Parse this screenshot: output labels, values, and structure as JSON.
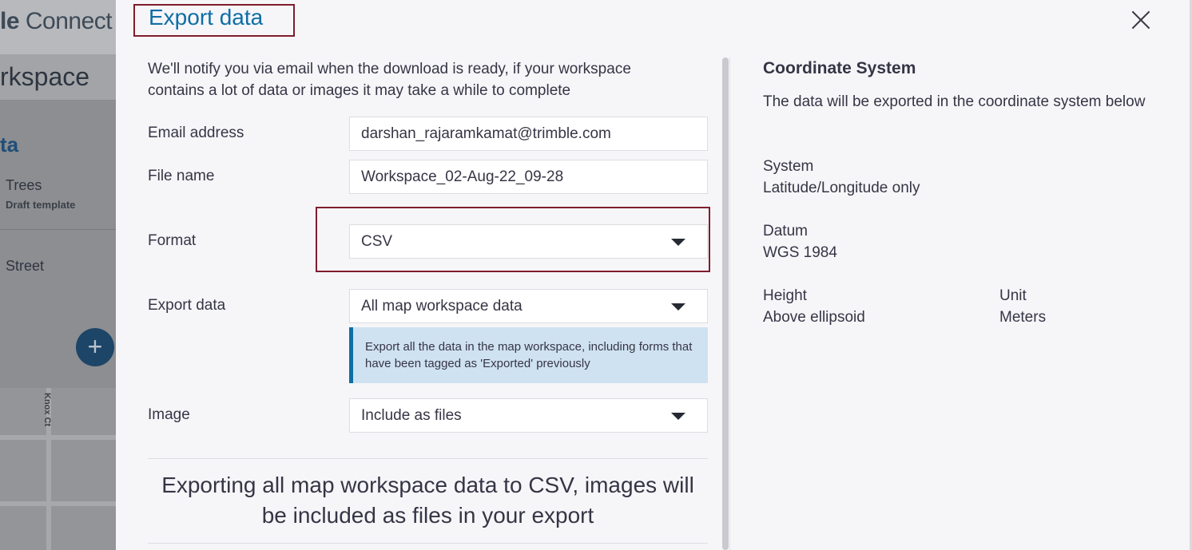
{
  "background_app": {
    "brand_bold": "le",
    "brand_rest": " Connect",
    "workspace_title": "rkspace",
    "data_heading": "ta",
    "items": [
      {
        "title": "Trees",
        "subtitle": "Draft template"
      },
      {
        "title": "Street",
        "subtitle": ""
      }
    ],
    "add_label": "+",
    "map_street_label": "Knox Ct"
  },
  "dialog": {
    "title": "Export data",
    "close_label": "×",
    "intro": "We'll notify you via email when the download is ready, if your workspace contains a lot of data or images it may take a while to complete",
    "fields": {
      "email": {
        "label": "Email address",
        "value": "darshan_rajaramkamat@trimble.com"
      },
      "file_name": {
        "label": "File name",
        "value": "Workspace_02-Aug-22_09-28"
      },
      "format": {
        "label": "Format",
        "value": "CSV"
      },
      "export_data": {
        "label": "Export data",
        "value": "All map workspace data",
        "info": "Export all the data in the map workspace, including forms that have been tagged as 'Exported' previously"
      },
      "image": {
        "label": "Image",
        "value": "Include as files"
      }
    },
    "summary": "Exporting all map workspace data to CSV, images will be included as files in your export"
  },
  "coordinate_system": {
    "title": "Coordinate System",
    "description": "The data will be exported in the coordinate system below",
    "system_label": "System",
    "system_value": "Latitude/Longitude only",
    "datum_label": "Datum",
    "datum_value": "WGS 1984",
    "height_label": "Height",
    "height_value": "Above ellipsoid",
    "unit_label": "Unit",
    "unit_value": "Meters"
  },
  "colors": {
    "accent": "#0e6ea5",
    "highlight_border": "#7f1d2d",
    "info_bg": "#cfe2f1",
    "dialog_bg": "#f6f6f9"
  }
}
